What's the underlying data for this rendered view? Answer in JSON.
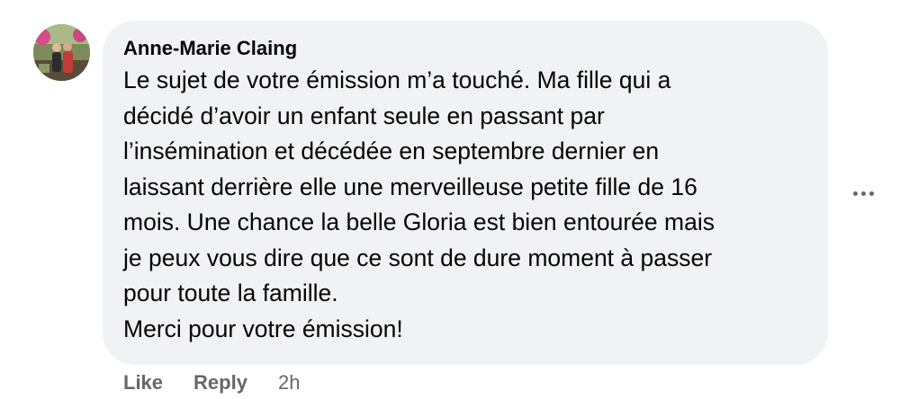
{
  "comment": {
    "author": "Anne-Marie Claing",
    "avatar_alt": "",
    "body_lines": [
      "Le sujet de votre émission m’a touché. Ma fille qui a",
      "décidé d’avoir un enfant seule en passant par",
      "l’insémination et décédée en septembre dernier en",
      "laissant derrière elle une merveilleuse petite fille de 16",
      "mois. Une chance la belle Gloria est bien entourée mais",
      "je peux vous dire que ce sont de dure moment à passer",
      "pour toute la famille.",
      "Merci pour votre émission!"
    ],
    "actions": {
      "like_label": "Like",
      "reply_label": "Reply",
      "timestamp": "2h"
    },
    "more_icon": "more-horizontal-icon"
  },
  "colors": {
    "bubble_bg": "#f0f2f5",
    "text": "#050505",
    "secondary_text": "#65676b"
  }
}
